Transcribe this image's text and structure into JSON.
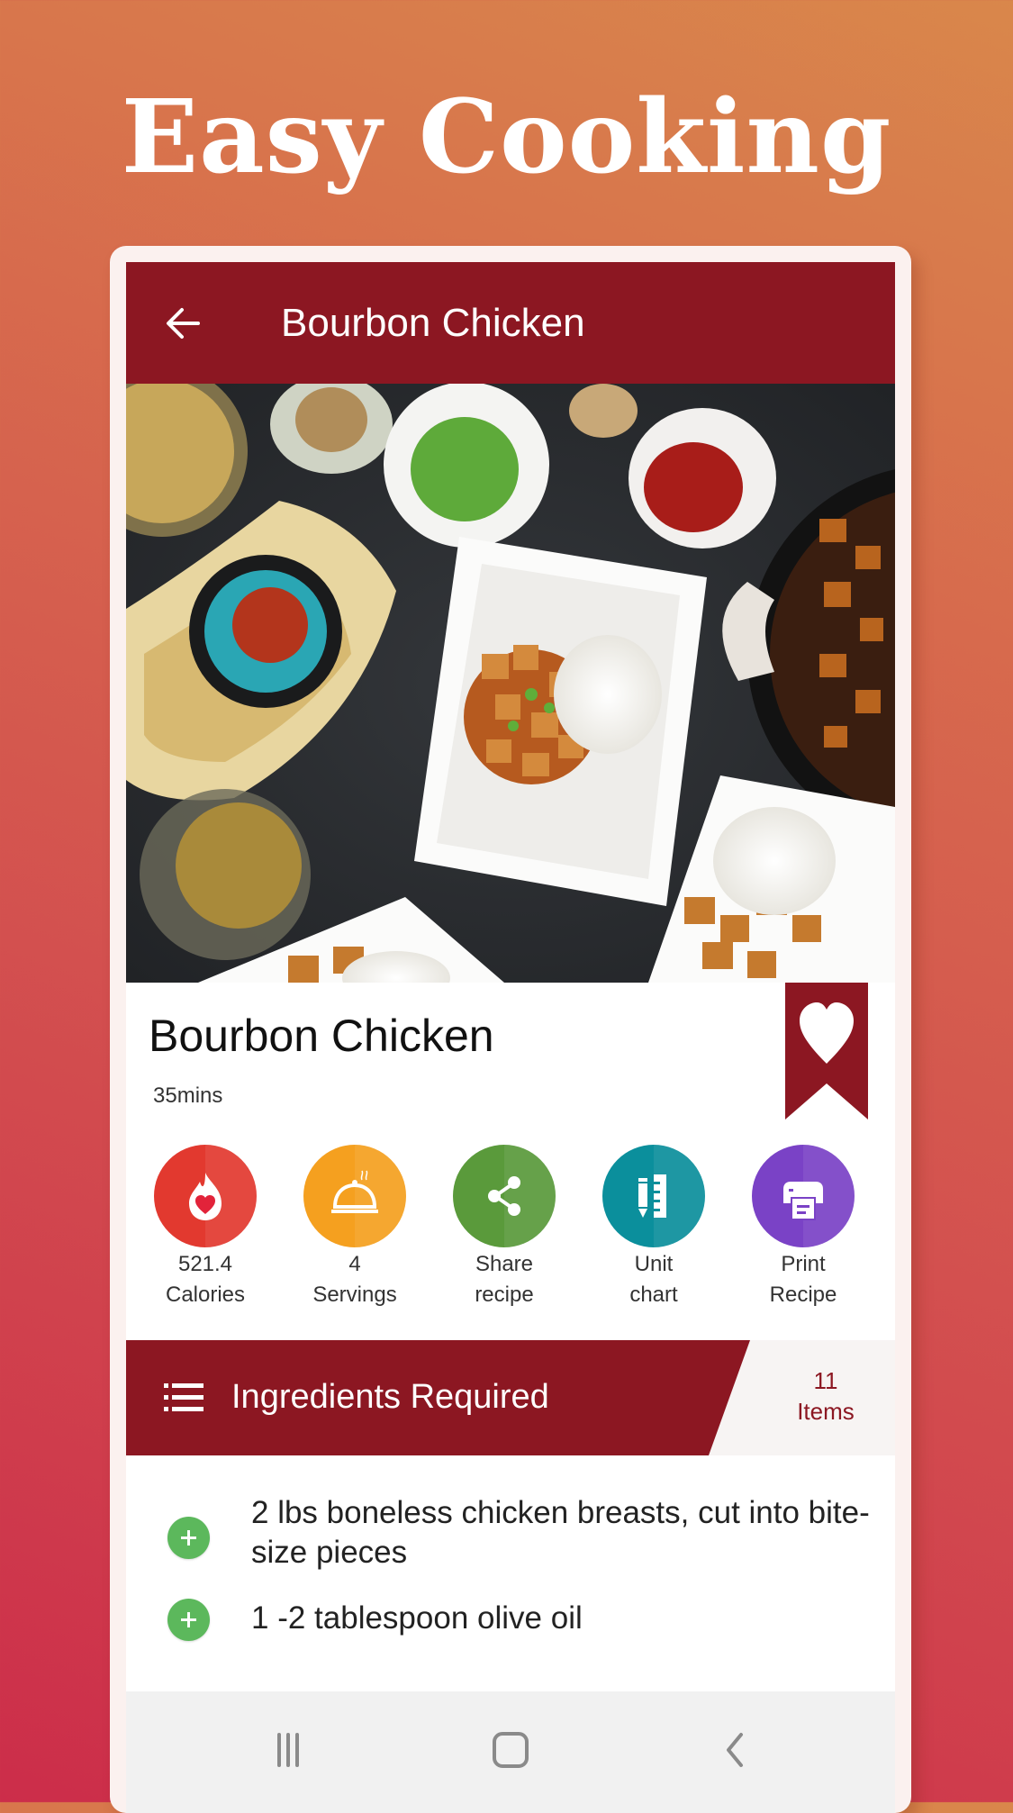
{
  "promo": {
    "headline": "Easy Cooking"
  },
  "appbar": {
    "title": "Bourbon Chicken",
    "back_icon": "arrow-left-icon"
  },
  "hero": {
    "alt": "Bourbon chicken with rice in square white bowls, with small dishes of scallions, ketchup, sesame seeds, chili flakes and glasses of drink"
  },
  "recipe": {
    "title": "Bourbon Chicken",
    "time": "35mins",
    "favorite_icon": "heart-bookmark-icon"
  },
  "actions": [
    {
      "line1": "521.4",
      "line2": "Calories",
      "icon": "calorie-flame-heart-icon",
      "color": "#e2392f"
    },
    {
      "line1": "4",
      "line2": "Servings",
      "icon": "serving-cloche-icon",
      "color": "#f5a01f"
    },
    {
      "line1": "Share",
      "line2": "recipe",
      "icon": "share-icon",
      "color": "#5a9a3b"
    },
    {
      "line1": "Unit",
      "line2": "chart",
      "icon": "ruler-pencil-icon",
      "color": "#0b8f9c"
    },
    {
      "line1": "Print",
      "line2": "Recipe",
      "icon": "printer-icon",
      "color": "#7a42c6"
    }
  ],
  "ingredients": {
    "header": "Ingredients Required",
    "count": "11",
    "count_label": "Items",
    "items": [
      "2 lbs boneless chicken breasts, cut into bite-size pieces",
      "1 -2 tablespoon olive oil"
    ]
  },
  "colors": {
    "primary": "#8c1722",
    "add": "#5cb85c"
  },
  "navbar": {
    "recents": "recents-icon",
    "home": "home-icon",
    "back": "back-icon"
  }
}
